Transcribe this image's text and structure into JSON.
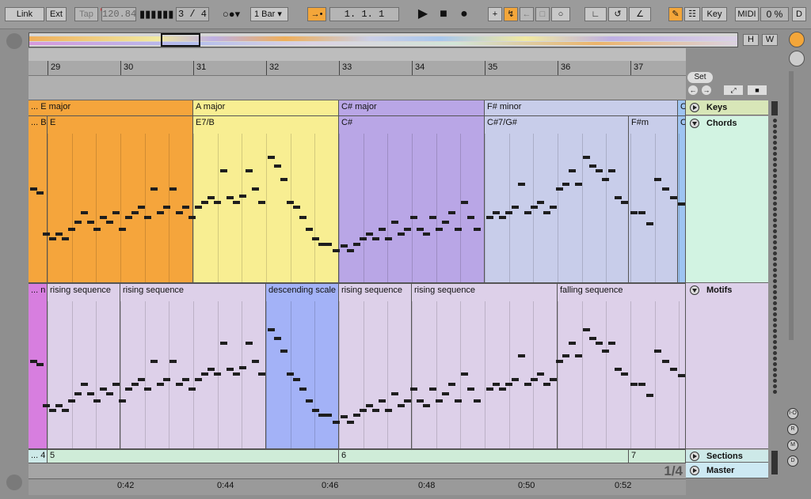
{
  "toolbar": {
    "link": "Link",
    "ext": "Ext",
    "tap": "Tap",
    "tempo": "120.84",
    "time_signature": "3 / 4",
    "quantize": "1 Bar",
    "position": "1.   1.   1",
    "key": "Key",
    "midi": "MIDI",
    "cpu": "0 %",
    "d": "D"
  },
  "overview": {
    "h_button": "H",
    "w_button": "W"
  },
  "set_button": "Set",
  "bars": [
    "29",
    "30",
    "31",
    "32",
    "33",
    "34",
    "35",
    "36",
    "37"
  ],
  "keys_clips": [
    {
      "label": "... E major",
      "color": "#f5a53c"
    },
    {
      "label": "A major",
      "color": "#f8ee92"
    },
    {
      "label": "C# major",
      "color": "#b9a6e6"
    },
    {
      "label": "F# minor",
      "color": "#c8cdea"
    },
    {
      "label": "C",
      "color": "#9ec4f2"
    }
  ],
  "chord_clips": [
    {
      "label": "... B",
      "color": "#f5a53c"
    },
    {
      "label": "E",
      "color": "#f5a53c"
    },
    {
      "label": "E7/B",
      "color": "#f8ee92"
    },
    {
      "label": "C#",
      "color": "#b9a6e6"
    },
    {
      "label": "C#7/G#",
      "color": "#c8cdea"
    },
    {
      "label": "F#m",
      "color": "#c8cdea"
    },
    {
      "label": "C",
      "color": "#9ec4f2"
    }
  ],
  "motif_clips": [
    {
      "label": "... n",
      "color": "#d77edf"
    },
    {
      "label": "rising sequence",
      "color": "#ddd0e9"
    },
    {
      "label": "rising sequence",
      "color": "#ddd0e9"
    },
    {
      "label": "descending scale",
      "color": "#a3b2f7"
    },
    {
      "label": "rising sequence",
      "color": "#ddd0e9"
    },
    {
      "label": "rising sequence",
      "color": "#ddd0e9"
    },
    {
      "label": "falling sequence",
      "color": "#ddd0e9"
    }
  ],
  "section_clips": [
    {
      "label": "... 4",
      "color": "#cde9e8"
    },
    {
      "label": "5",
      "color": "#cfecd8"
    },
    {
      "label": "6",
      "color": "#cfecd8"
    },
    {
      "label": "7",
      "color": "#cfecd8"
    }
  ],
  "tracks": {
    "keys": "Keys",
    "chords": "Chords",
    "motifs": "Motifs",
    "sections": "Sections",
    "master": "Master"
  },
  "zoom_indicator": "1/4",
  "time_labels": [
    "0:42",
    "0:44",
    "0:46",
    "0:48",
    "0:50",
    "0:52"
  ],
  "side_buttons": [
    "I-O",
    "R",
    "M",
    "D"
  ]
}
